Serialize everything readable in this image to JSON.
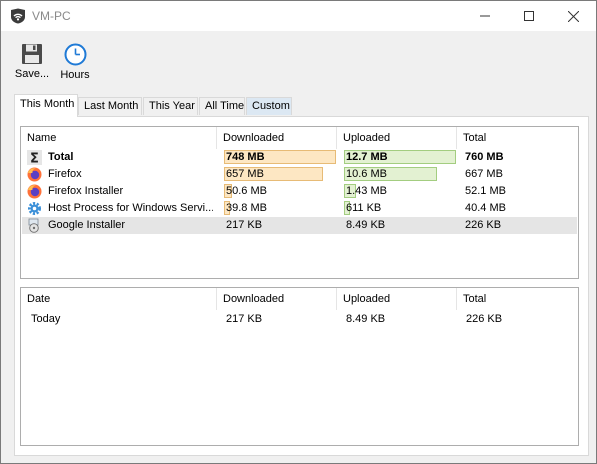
{
  "window": {
    "title": "VM-PC",
    "app_icon": "shield-wifi-icon"
  },
  "toolbar": {
    "save_label": "Save...",
    "save_icon": "floppy-disk-icon",
    "hours_label": "Hours",
    "hours_icon": "clock-icon"
  },
  "tabs": [
    {
      "label": "This Month",
      "active": true
    },
    {
      "label": "Last Month",
      "active": false
    },
    {
      "label": "This Year",
      "active": false
    },
    {
      "label": "All Time",
      "active": false
    },
    {
      "label": "Custom",
      "active": false
    }
  ],
  "apps_table": {
    "columns": [
      "Name",
      "Downloaded",
      "Uploaded",
      "Total"
    ],
    "rows": [
      {
        "name": "Total",
        "icon": "sigma-icon",
        "downloaded": "748 MB",
        "uploaded": "12.7 MB",
        "total": "760 MB",
        "dl_fraction": 1.0,
        "ul_fraction": 1.0,
        "bold": true
      },
      {
        "name": "Firefox",
        "icon": "firefox-icon",
        "downloaded": "657 MB",
        "uploaded": "10.6 MB",
        "total": "667 MB",
        "dl_fraction": 0.88,
        "ul_fraction": 0.83
      },
      {
        "name": "Firefox Installer",
        "icon": "firefox-icon",
        "downloaded": "50.6 MB",
        "uploaded": "1.43 MB",
        "total": "52.1 MB",
        "dl_fraction": 0.07,
        "ul_fraction": 0.11
      },
      {
        "name": "Host Process for Windows Servi...",
        "icon": "gear-icon",
        "downloaded": "39.8 MB",
        "uploaded": "611 KB",
        "total": "40.4 MB",
        "dl_fraction": 0.05,
        "ul_fraction": 0.05
      },
      {
        "name": "Google Installer",
        "icon": "installer-icon",
        "downloaded": "217 KB",
        "uploaded": "8.49 KB",
        "total": "226 KB",
        "dl_fraction": 0.0,
        "ul_fraction": 0.0,
        "selected": true
      }
    ]
  },
  "dates_table": {
    "columns": [
      "Date",
      "Downloaded",
      "Uploaded",
      "Total"
    ],
    "rows": [
      {
        "date": "Today",
        "downloaded": "217 KB",
        "uploaded": "8.49 KB",
        "total": "226 KB"
      }
    ]
  },
  "colors": {
    "download_bar": "#fde7c3",
    "upload_bar": "#e3f1d2",
    "selection": "#e5e5e5",
    "custom_tab": "#dce8f3"
  }
}
